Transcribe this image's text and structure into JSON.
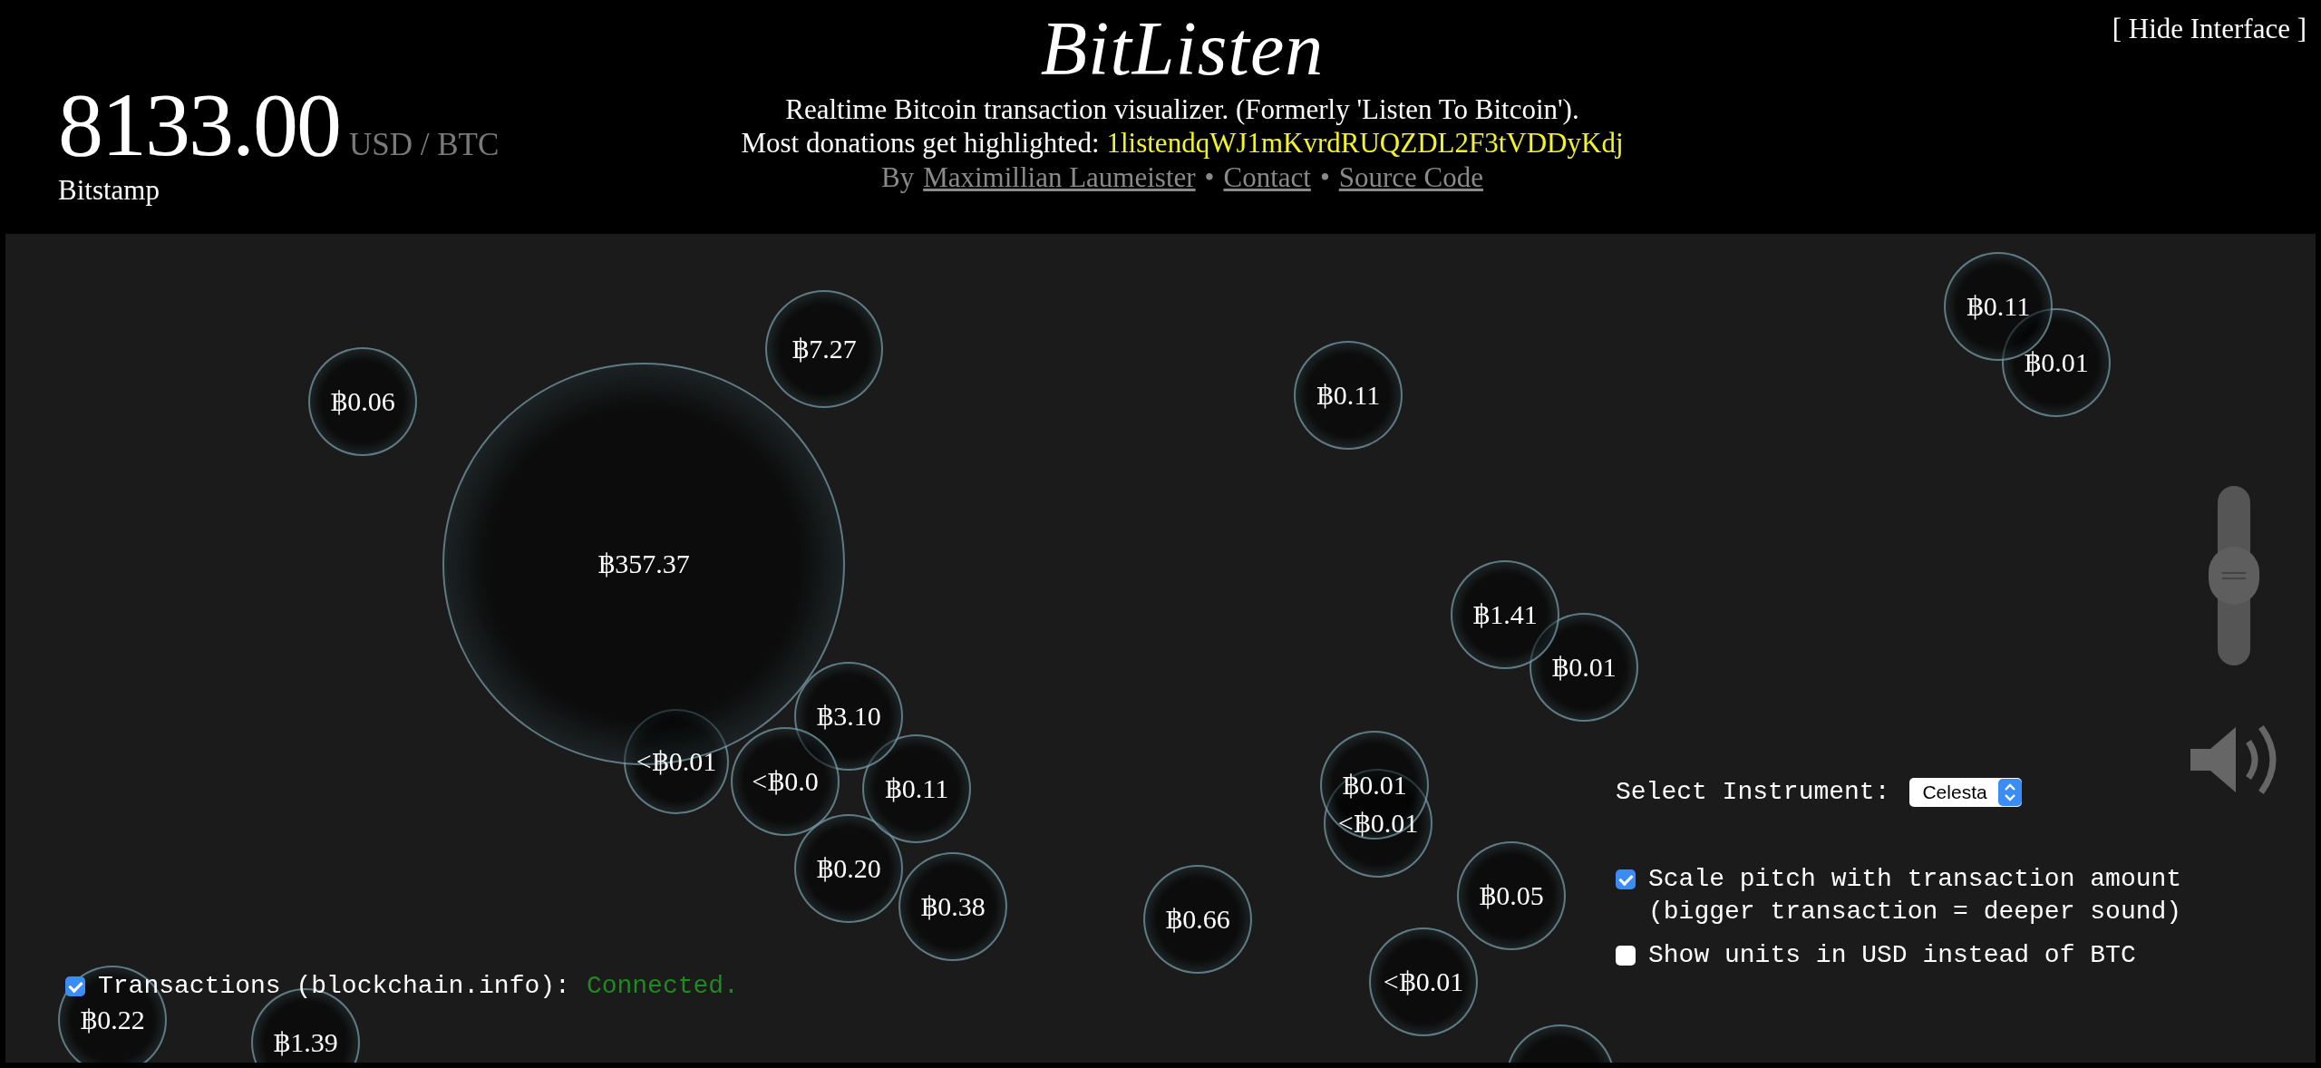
{
  "header": {
    "price": "8133.00",
    "price_unit": "USD / BTC",
    "exchange": "Bitstamp",
    "title": "BitListen",
    "tagline": "Realtime Bitcoin transaction visualizer. (Formerly 'Listen To Bitcoin').",
    "donation_label": "Most donations get highlighted:",
    "donation_address": "1listendqWJ1mKvrdRUQZDL2F3tVDDyKdj",
    "byline": [
      {
        "kind": "text",
        "text": "By"
      },
      {
        "kind": "link",
        "text": "Maximillian Laumeister"
      },
      {
        "kind": "text",
        "text": "•"
      },
      {
        "kind": "link",
        "text": "Contact"
      },
      {
        "kind": "text",
        "text": "•"
      },
      {
        "kind": "link",
        "text": "Source Code"
      }
    ],
    "hide_interface": "[ Hide Interface ]"
  },
  "bubbles": [
    {
      "amount": "฿0.06"
    },
    {
      "amount": "฿7.27"
    },
    {
      "amount": "฿357.37"
    },
    {
      "amount": "฿0.11"
    },
    {
      "amount": "฿0.11"
    },
    {
      "amount": "฿0.01"
    },
    {
      "amount": "฿1.41"
    },
    {
      "amount": "฿0.01"
    },
    {
      "amount": "<฿0.01"
    },
    {
      "amount": "<฿0.0"
    },
    {
      "amount": "฿3.10"
    },
    {
      "amount": "฿0.11"
    },
    {
      "amount": "฿0.20"
    },
    {
      "amount": "฿0.38"
    },
    {
      "amount": "฿0.01"
    },
    {
      "amount": "<฿0.01"
    },
    {
      "amount": "฿0.05"
    },
    {
      "amount": "<฿0.01"
    },
    {
      "amount": "฿0.66"
    },
    {
      "amount": "฿0.22"
    },
    {
      "amount": "฿1.39"
    }
  ],
  "controls": {
    "instrument_label": "Select Instrument:",
    "instrument": "Celesta",
    "volume": {
      "level": 0.5
    },
    "options": [
      {
        "label": "Scale pitch with transaction amount (bigger transaction = deeper sound)",
        "checked": true
      },
      {
        "label": "Show units in USD instead of BTC",
        "checked": false
      }
    ]
  },
  "status": {
    "checked": true,
    "label": "Transactions (blockchain.info):",
    "state": "Connected."
  }
}
